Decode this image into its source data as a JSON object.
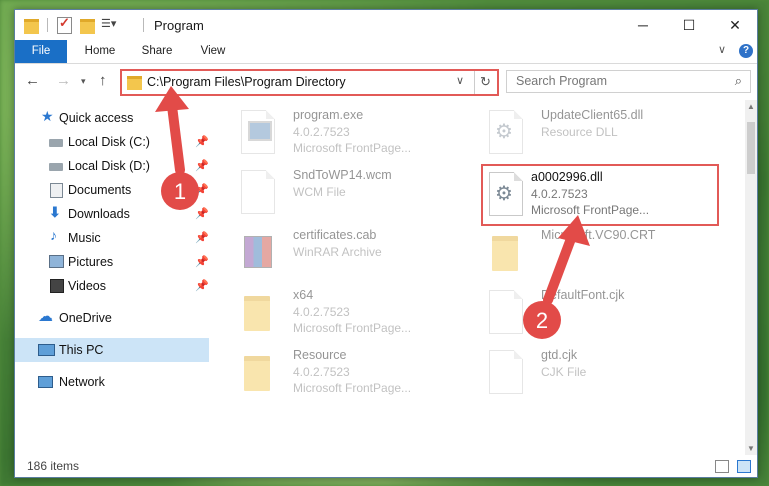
{
  "window": {
    "title": "Program",
    "min_glyph": "─",
    "max_glyph": "☐",
    "close_glyph": "✕"
  },
  "ribbon": {
    "tabs": [
      "File",
      "Home",
      "Share",
      "View"
    ],
    "help_glyph": "?"
  },
  "nav": {
    "back_glyph": "←",
    "forward_glyph": "→",
    "recent_glyph": "▾",
    "up_glyph": "↑",
    "address": "C:\\Program Files\\Program Directory",
    "address_drop_glyph": "∨",
    "refresh_glyph": "↻",
    "search_placeholder": "Search Program",
    "search_glyph": "⌕"
  },
  "sidebar": {
    "items": [
      {
        "label": "Quick access",
        "icon": "star-icon"
      },
      {
        "label": "Local Disk (C:)",
        "icon": "disk-icon",
        "pinned": true
      },
      {
        "label": "Local Disk (D:)",
        "icon": "disk-icon",
        "pinned": true
      },
      {
        "label": "Documents",
        "icon": "documents-icon",
        "pinned": true
      },
      {
        "label": "Downloads",
        "icon": "download-icon",
        "pinned": true
      },
      {
        "label": "Music",
        "icon": "music-icon",
        "pinned": true
      },
      {
        "label": "Pictures",
        "icon": "pictures-icon",
        "pinned": true
      },
      {
        "label": "Videos",
        "icon": "videos-icon",
        "pinned": true
      },
      {
        "label": "OneDrive",
        "icon": "cloud-icon"
      },
      {
        "label": "This PC",
        "icon": "computer-icon",
        "selected": true
      },
      {
        "label": "Network",
        "icon": "network-icon"
      }
    ],
    "pin_glyph": "📌",
    "star_glyph": "★",
    "down_glyph": "⬇",
    "music_glyph": "♪",
    "cloud_glyph": "☁"
  },
  "files": [
    {
      "name": "program.exe",
      "line2": "4.0.2.7523",
      "line3": "Microsoft FrontPage..."
    },
    {
      "name": "UpdateClient65.dll",
      "line2": "Resource DLL",
      "line3": ""
    },
    {
      "name": "SndToWP14.wcm",
      "line2": "WCM File",
      "line3": ""
    },
    {
      "name": "a0002996.dll",
      "line2": "4.0.2.7523",
      "line3": "Microsoft FrontPage..."
    },
    {
      "name": "certificates.cab",
      "line2": "WinRAR Archive",
      "line3": ""
    },
    {
      "name": "Microsoft.VC90.CRT",
      "line2": "",
      "line3": ""
    },
    {
      "name": "x64",
      "line2": "4.0.2.7523",
      "line3": "Microsoft FrontPage..."
    },
    {
      "name": "DefaultFont.cjk",
      "line2": "",
      "line3": ""
    },
    {
      "name": "Resource",
      "line2": "4.0.2.7523",
      "line3": "Microsoft FrontPage..."
    },
    {
      "name": "gtd.cjk",
      "line2": "CJK File",
      "line3": ""
    }
  ],
  "status": {
    "item_count": "186 items"
  },
  "annotations": {
    "step1": "1",
    "step2": "2",
    "color": "#e24b48"
  }
}
